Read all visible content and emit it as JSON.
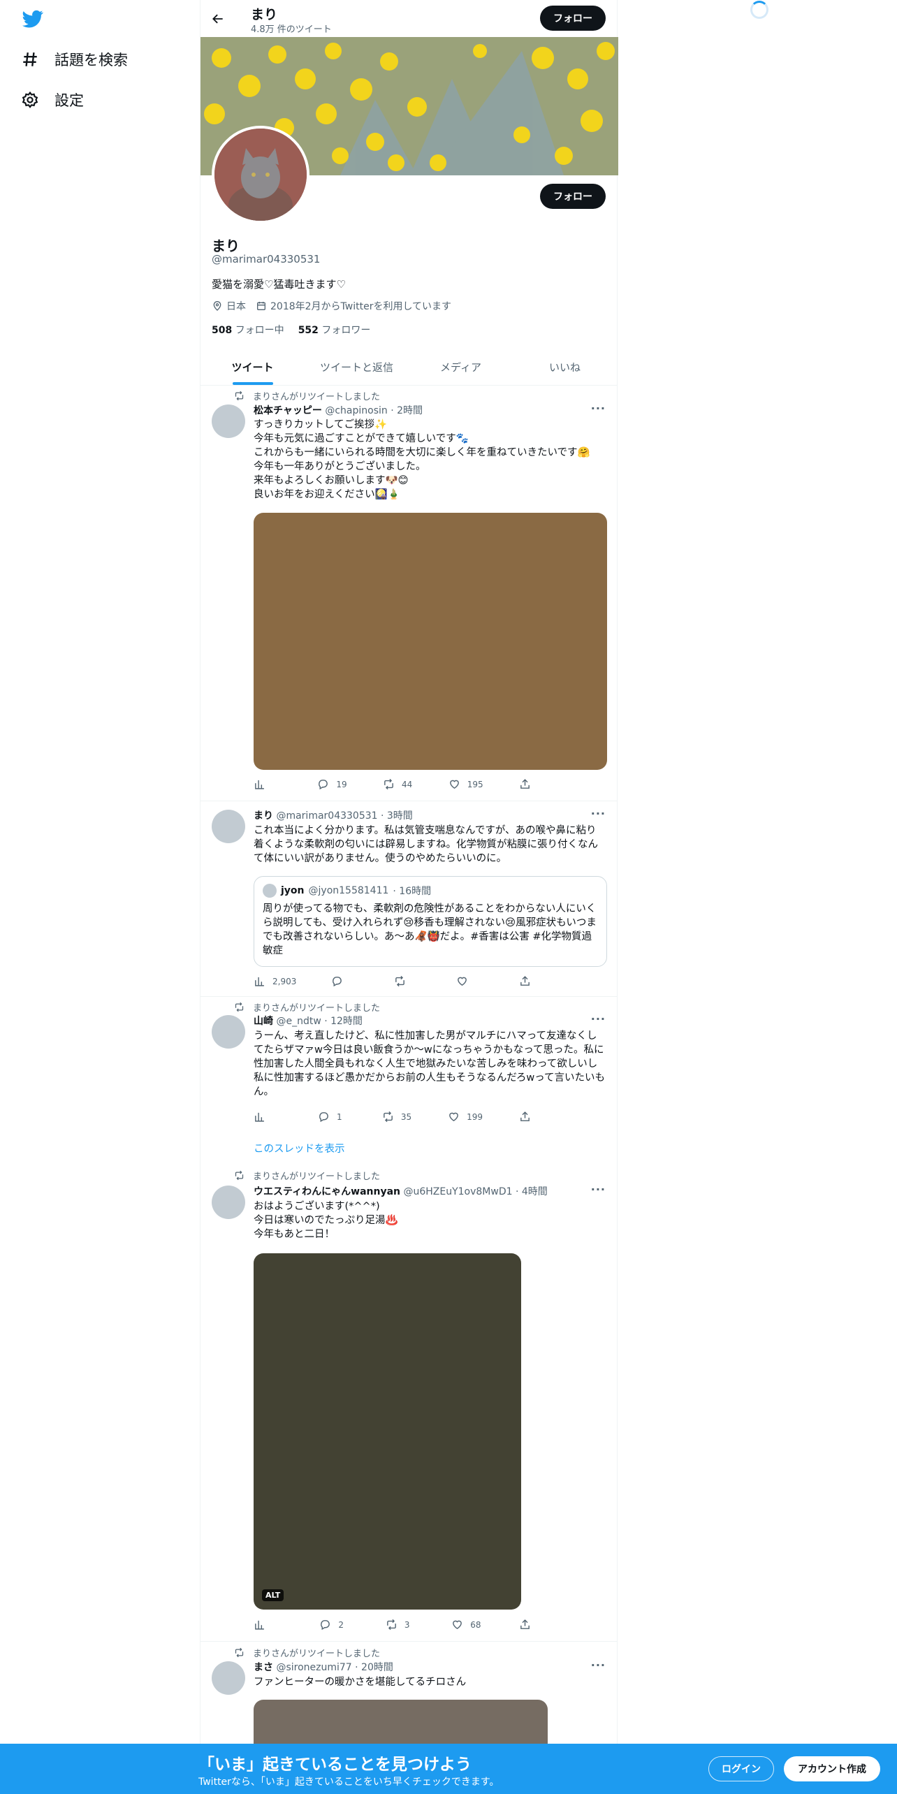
{
  "nav": {
    "items": [
      {
        "label": "話題を検索",
        "icon": "hashtag-icon"
      },
      {
        "label": "設定",
        "icon": "gear-icon"
      }
    ]
  },
  "header": {
    "name": "まり",
    "tweet_count": "4.8万 件のツイート",
    "follow_label": "フォロー"
  },
  "profile": {
    "name": "まり",
    "handle": "@marimar04330531",
    "bio": "愛猫を溺愛♡猛毒吐きます♡",
    "location": "日本",
    "joined": "2018年2月からTwitterを利用しています",
    "following_count": "508",
    "following_label": "フォロー中",
    "followers_count": "552",
    "followers_label": "フォロワー",
    "follow_label": "フォロー"
  },
  "tabs": [
    "ツイート",
    "ツイートと返信",
    "メディア",
    "いいね"
  ],
  "tweets": [
    {
      "retweeted_by": "まりさんがリツイートしました",
      "name": "松本チャッピー",
      "handle": "@chapinosin",
      "time": "· 2時間",
      "text": "すっきりカットしてご挨拶✨\n今年も元気に過ごすことができて嬉しいです🐾\nこれからも一緒にいられる時間を大切に楽しく年を重ねていきたいです🤗\n今年も一年ありがとうございました。\n来年もよろしくお願いします🐶😊\n良いお年をお迎えください🎑🎍",
      "media_color": "#8a6a44",
      "stats": {
        "views": "",
        "replies": "19",
        "retweets": "44",
        "likes": "195"
      }
    },
    {
      "retweeted_by": "",
      "name": "まり",
      "handle": "@marimar04330531",
      "time": "· 3時間",
      "text": "これ本当によく分かります。私は気管支喘息なんですが、あの喉や鼻に粘り着くような柔軟剤の匂いには辟易しますね。化学物質が粘膜に張り付くなんて体にいい訳がありません。使うのやめたらいいのに。",
      "quote": {
        "name": "jyon",
        "handle": "@jyon15581411",
        "time": "· 16時間",
        "text": "周りが使ってる物でも、柔軟剤の危険性があることをわからない人にいくら説明しても、受け入れられず😢移香も理解されない😢風邪症状もいつまでも改善されないらしい。あ～あ🦧👹だよ。#香害は公害 #化学物質過敏症"
      },
      "stats": {
        "views": "2,903",
        "replies": "",
        "retweets": "",
        "likes": ""
      }
    },
    {
      "retweeted_by": "まりさんがリツイートしました",
      "name": "山崎",
      "handle": "@e_ndtw",
      "time": "· 12時間",
      "text": "うーん、考え直したけど、私に性加害した男がマルチにハマって友達なくしてたらザマァw今日は良い飯食うか～wになっちゃうかもなって思った。私に性加害した人間全員もれなく人生で地獄みたいな苦しみを味わって欲しいし私に性加害するほど愚かだからお前の人生もそうなるんだろwって言いたいもん。",
      "thread_link": "このスレッドを表示",
      "stats": {
        "views": "",
        "replies": "1",
        "retweets": "35",
        "likes": "199"
      }
    },
    {
      "retweeted_by": "まりさんがリツイートしました",
      "name": "ウエスティわんにゃんwannyan",
      "handle": "@u6HZEuY1ov8MwD1",
      "time": "· 4時間",
      "text": "おはようございます(*^^*)\n今日は寒いのでたっぷり足湯♨️\n今年もあと二日！",
      "media_color": "#434233",
      "alt": "ALT",
      "stats": {
        "views": "",
        "replies": "2",
        "retweets": "3",
        "likes": "68"
      }
    },
    {
      "retweeted_by": "まりさんがリツイートしました",
      "name": "まさ",
      "handle": "@sironezumi77",
      "time": "· 20時間",
      "text": "ファンヒーターの暖かさを堪能してるチロさん",
      "media_color": "#766c62"
    }
  ],
  "bottom_bar": {
    "title": "「いま」起きていることを見つけよう",
    "subtitle": "Twitterなら、「いま」起きていることをいち早くチェックできます。",
    "login": "ログイン",
    "signup": "アカウント作成"
  },
  "colors": {
    "accent": "#1d9bf0",
    "text": "#0f1419",
    "secondary": "#536471"
  }
}
